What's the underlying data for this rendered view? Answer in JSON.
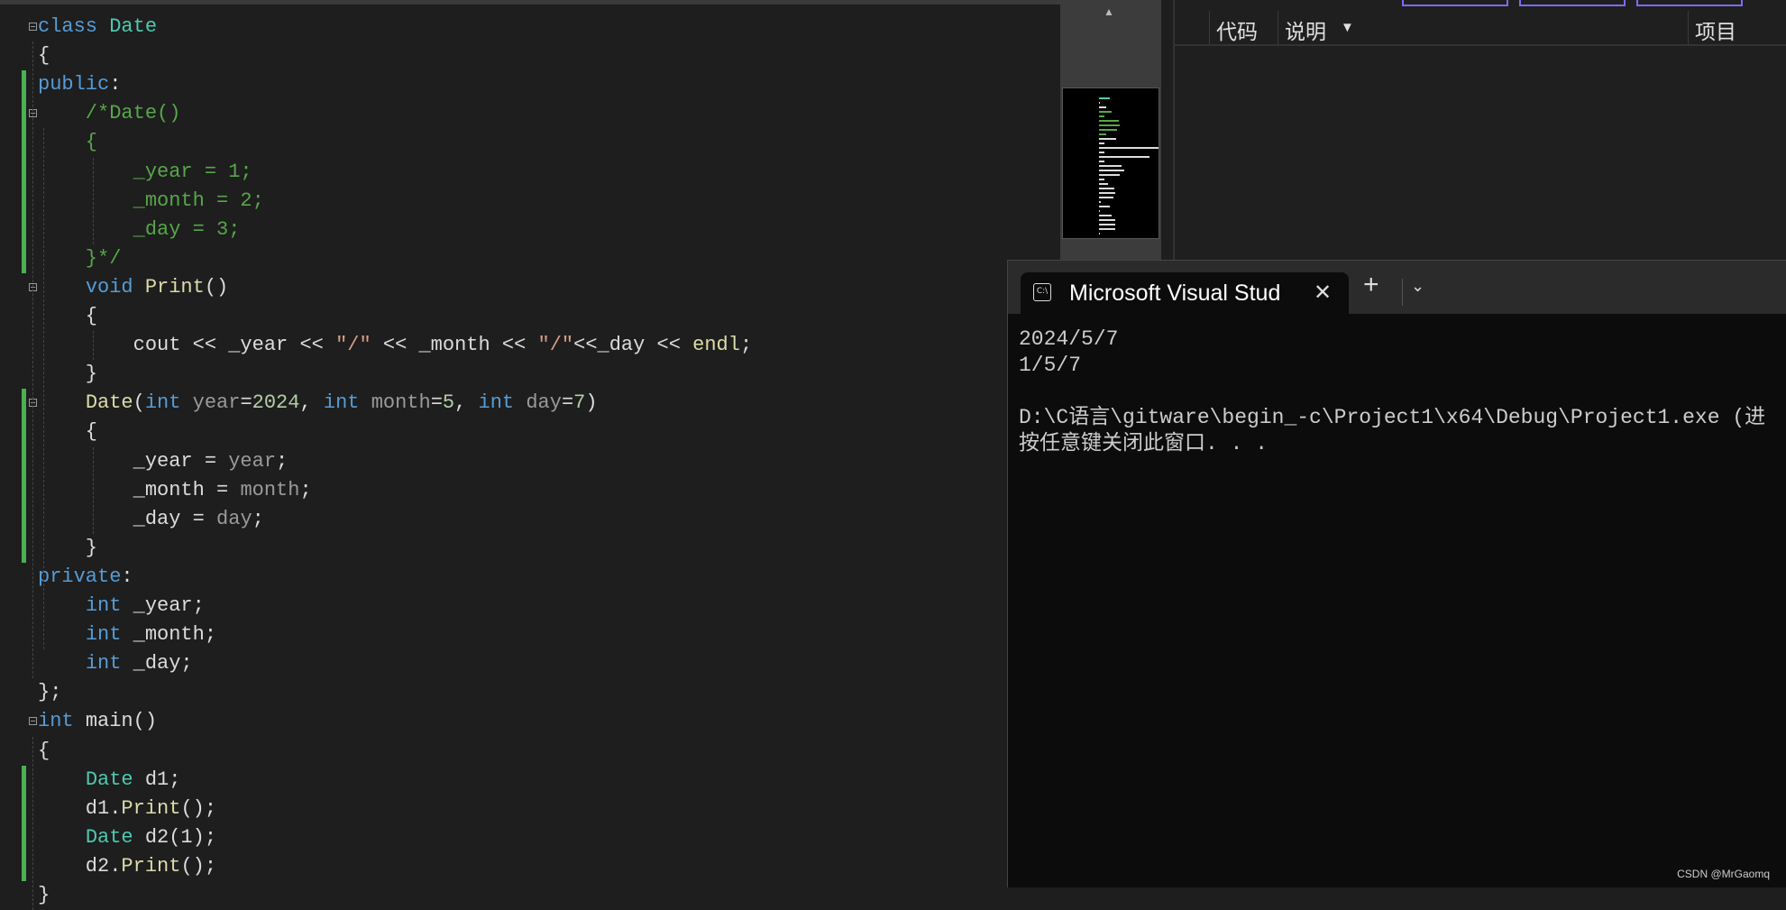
{
  "editor": {
    "colors": {
      "kw": "#569cd6",
      "type": "#4ec9b0",
      "cm": "#57a64a",
      "fn": "#dcdcaa",
      "param": "#9a9a9a",
      "num": "#b5cea8",
      "str": "#d69d85",
      "txt": "#dcdcdc"
    },
    "lines": [
      [
        [
          "kw",
          "class "
        ],
        [
          "type",
          "Date"
        ]
      ],
      [
        [
          "txt",
          "{"
        ]
      ],
      [
        [
          "kw",
          "public"
        ],
        [
          "txt",
          ":"
        ]
      ],
      [
        [
          "cm",
          "    /*Date()"
        ]
      ],
      [
        [
          "cm",
          "    {"
        ]
      ],
      [
        [
          "cm",
          "        _year = 1;"
        ]
      ],
      [
        [
          "cm",
          "        _month = 2;"
        ]
      ],
      [
        [
          "cm",
          "        _day = 3;"
        ]
      ],
      [
        [
          "cm",
          "    }*/"
        ]
      ],
      [
        [
          "txt",
          "    "
        ],
        [
          "kw",
          "void "
        ],
        [
          "fn",
          "Print"
        ],
        [
          "txt",
          "()"
        ]
      ],
      [
        [
          "txt",
          "    {"
        ]
      ],
      [
        [
          "txt",
          "        cout << _year << "
        ],
        [
          "str",
          "\"/\""
        ],
        [
          "txt",
          " << _month << "
        ],
        [
          "str",
          "\"/\""
        ],
        [
          "txt",
          "<<_day << "
        ],
        [
          "fn",
          "endl"
        ],
        [
          "txt",
          ";"
        ]
      ],
      [
        [
          "txt",
          "    }"
        ]
      ],
      [
        [
          "txt",
          "    "
        ],
        [
          "fn",
          "Date"
        ],
        [
          "txt",
          "("
        ],
        [
          "kw",
          "int "
        ],
        [
          "param",
          "year"
        ],
        [
          "txt",
          "="
        ],
        [
          "num",
          "2024"
        ],
        [
          "txt",
          ", "
        ],
        [
          "kw",
          "int "
        ],
        [
          "param",
          "month"
        ],
        [
          "txt",
          "="
        ],
        [
          "num",
          "5"
        ],
        [
          "txt",
          ", "
        ],
        [
          "kw",
          "int "
        ],
        [
          "param",
          "day"
        ],
        [
          "txt",
          "="
        ],
        [
          "num",
          "7"
        ],
        [
          "txt",
          ")"
        ]
      ],
      [
        [
          "txt",
          "    {"
        ]
      ],
      [
        [
          "txt",
          "        _year = "
        ],
        [
          "param",
          "year"
        ],
        [
          "txt",
          ";"
        ]
      ],
      [
        [
          "txt",
          "        _month = "
        ],
        [
          "param",
          "month"
        ],
        [
          "txt",
          ";"
        ]
      ],
      [
        [
          "txt",
          "        _day = "
        ],
        [
          "param",
          "day"
        ],
        [
          "txt",
          ";"
        ]
      ],
      [
        [
          "txt",
          "    }"
        ]
      ],
      [
        [
          "kw",
          "private"
        ],
        [
          "txt",
          ":"
        ]
      ],
      [
        [
          "txt",
          "    "
        ],
        [
          "kw",
          "int "
        ],
        [
          "txt",
          "_year;"
        ]
      ],
      [
        [
          "txt",
          "    "
        ],
        [
          "kw",
          "int "
        ],
        [
          "txt",
          "_month;"
        ]
      ],
      [
        [
          "txt",
          "    "
        ],
        [
          "kw",
          "int "
        ],
        [
          "txt",
          "_day;"
        ]
      ],
      [
        [
          "txt",
          "};"
        ]
      ],
      [
        [
          "kw",
          "int "
        ],
        [
          "txt",
          "main()"
        ]
      ],
      [
        [
          "txt",
          "{"
        ]
      ],
      [
        [
          "txt",
          "    "
        ],
        [
          "type",
          "Date "
        ],
        [
          "txt",
          "d1;"
        ]
      ],
      [
        [
          "txt",
          "    d1."
        ],
        [
          "fn",
          "Print"
        ],
        [
          "txt",
          "();"
        ]
      ],
      [
        [
          "txt",
          "    "
        ],
        [
          "type",
          "Date "
        ],
        [
          "txt",
          "d2(1);"
        ]
      ],
      [
        [
          "txt",
          "    d2."
        ],
        [
          "fn",
          "Print"
        ],
        [
          "txt",
          "();"
        ]
      ],
      [
        [
          "txt",
          "}"
        ]
      ]
    ]
  },
  "error_list": {
    "columns": [
      "代码",
      "说明",
      "项目"
    ],
    "dropdown_icon": "caret-down-icon"
  },
  "terminal": {
    "tab_title": "Microsoft Visual Stud",
    "tab_icon": "C:\\",
    "close_label": "✕",
    "new_tab_label": "+",
    "dropdown_label": "⌄",
    "output": [
      "2024/5/7",
      "1/5/7",
      "",
      "D:\\C语言\\gitware\\begin_-c\\Project1\\x64\\Debug\\Project1.exe (进",
      "按任意键关闭此窗口. . ."
    ]
  },
  "watermark": "CSDN @MrGaomq"
}
